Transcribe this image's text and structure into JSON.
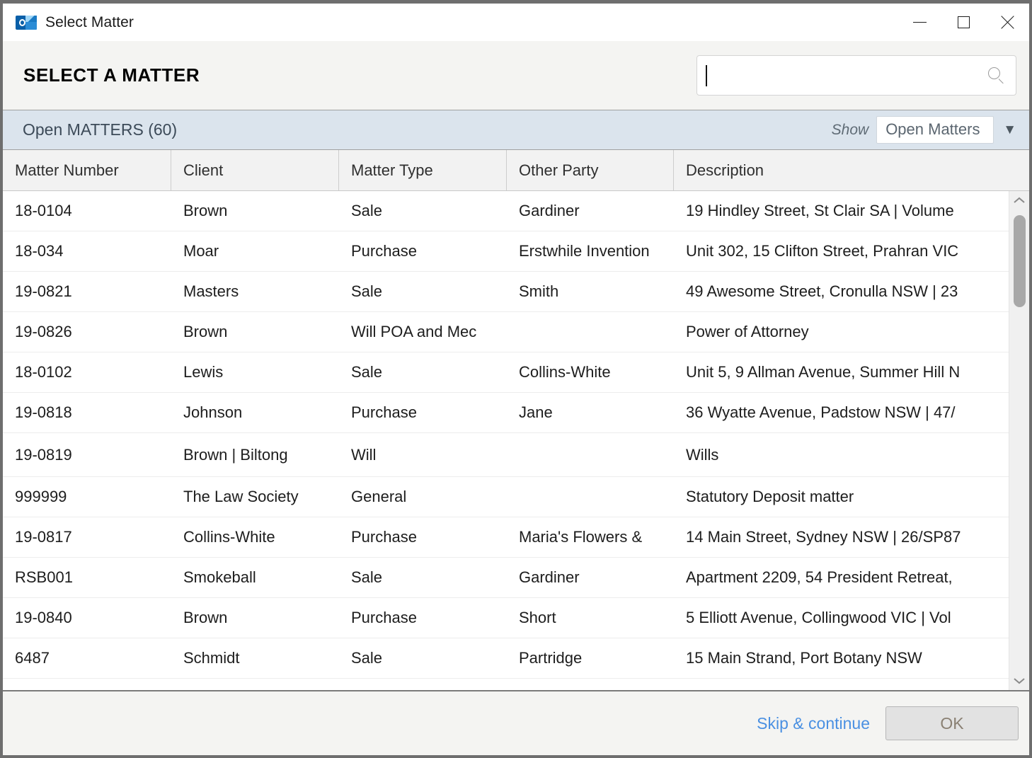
{
  "window": {
    "title": "Select Matter",
    "app_icon": "outlook-icon",
    "controls": {
      "minimize": "minimize-icon",
      "maximize": "maximize-icon",
      "close": "close-icon"
    }
  },
  "header": {
    "page_title": "SELECT A MATTER",
    "search": {
      "value": "",
      "placeholder": "",
      "icon": "search-icon"
    }
  },
  "strip": {
    "count_label": "Open MATTERS (60)",
    "show_label": "Show",
    "show_value": "Open Matters",
    "chevron": "▼",
    "options": [
      "Open Matters"
    ],
    "band_color": "#dbe4ed"
  },
  "grid": {
    "columns": [
      "Matter Number",
      "Client",
      "Matter Type",
      "Other Party",
      "Description"
    ],
    "rows": [
      {
        "matter_number": "18-0104",
        "client": "Brown",
        "matter_type": "Sale",
        "other_party": "Gardiner",
        "description": "19 Hindley Street, St Clair SA | Volume"
      },
      {
        "matter_number": "18-034",
        "client": "Moar",
        "matter_type": "Purchase",
        "other_party": "Erstwhile Invention",
        "description": "Unit 302, 15 Clifton Street, Prahran VIC"
      },
      {
        "matter_number": "19-0821",
        "client": "Masters",
        "matter_type": "Sale",
        "other_party": "Smith",
        "description": "49 Awesome Street, Cronulla NSW | 23"
      },
      {
        "matter_number": "19-0826",
        "client": "Brown",
        "matter_type": "Will POA and Mec",
        "other_party": "",
        "description": "Power of Attorney"
      },
      {
        "matter_number": "18-0102",
        "client": "Lewis",
        "matter_type": "Sale",
        "other_party": "Collins-White",
        "description": "Unit 5, 9 Allman Avenue, Summer Hill N"
      },
      {
        "matter_number": "19-0818",
        "client": "Johnson",
        "matter_type": "Purchase",
        "other_party": "Jane",
        "description": "36 Wyatte Avenue, Padstow NSW | 47/"
      },
      {
        "matter_number": "19-0819",
        "client": "Brown | Biltong",
        "matter_type": "Will",
        "other_party": "",
        "description": "Wills"
      },
      {
        "matter_number": "999999",
        "client": "The Law Society",
        "matter_type": "General",
        "other_party": "",
        "description": "Statutory Deposit matter"
      },
      {
        "matter_number": "19-0817",
        "client": "Collins-White",
        "matter_type": "Purchase",
        "other_party": "Maria's Flowers &",
        "description": "14 Main Street, Sydney NSW | 26/SP87"
      },
      {
        "matter_number": "RSB001",
        "client": "Smokeball",
        "matter_type": "Sale",
        "other_party": "Gardiner",
        "description": "Apartment 2209, 54 President Retreat,"
      },
      {
        "matter_number": "19-0840",
        "client": "Brown",
        "matter_type": "Purchase",
        "other_party": "Short",
        "description": "5 Elliott Avenue, Collingwood VIC | Vol"
      },
      {
        "matter_number": "6487",
        "client": "Schmidt",
        "matter_type": "Sale",
        "other_party": "Partridge",
        "description": "15 Main Strand, Port Botany NSW"
      }
    ]
  },
  "scrollbar": {
    "up_icon": "chevron-up-icon",
    "down_icon": "chevron-down-icon"
  },
  "footer": {
    "skip_label": "Skip & continue",
    "ok_label": "OK",
    "skip_color": "#4a90e2"
  }
}
